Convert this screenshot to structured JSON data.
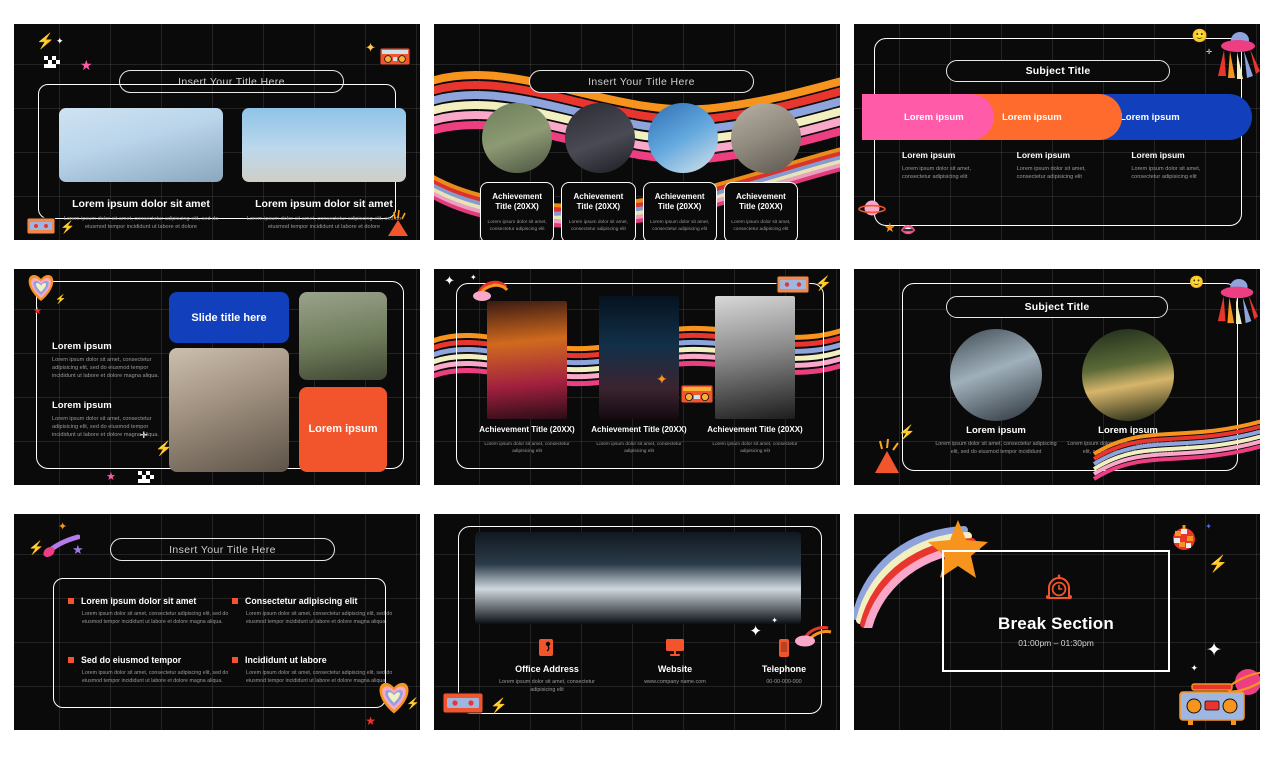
{
  "theme": {
    "bg": "#0a0a0a",
    "page_bg": "#ffffff",
    "accent_pink": "#FF5BA8",
    "accent_orange": "#FF6B2C",
    "accent_blue": "#1240BC",
    "accent_red_orange": "#F2552C",
    "text_muted": "#9a9a9a",
    "rainbow": [
      "#F7941E",
      "#E8352E",
      "#8FA3DC",
      "#F2EFC0",
      "#F9A8C9",
      "#ED3E82"
    ]
  },
  "lorem": {
    "short": "Lorem ipsum",
    "heading_long": "Lorem ipsum dolor sit amet",
    "body_3line": "Lorem ipsum dolor sit amet, consectetur adipiscing elit, sed do eiusmod tempor incididunt ut labore et dolore",
    "body_3line_b": "Lorem ipsum dolor sit amet, consectetur adipiscing elit",
    "body_5line": "Lorem ipsum dolor sit amet, consectetur adipiscing elit, sed do eiusmod tempor incididunt ut labore et dolore magna aliqua.",
    "body_4line": "Lorem ipsum dolor sit amet, consectetur adipiscing elit, sed do eiusmod tempor incididunt"
  },
  "slides": [
    {
      "index": 1,
      "name": "two-image-intro",
      "title": "Insert Your Title Here",
      "cards": [
        {
          "heading": "Lorem ipsum dolor sit amet",
          "body": "Lorem ipsum dolor sit amet, consectetur adipiscing elit, sed do eiusmod tempor incididunt ut labore et dolore"
        },
        {
          "heading": "Lorem ipsum dolor sit amet",
          "body": "Lorem ipsum dolor sit amet, consectetur adipiscing elit, sed do eiusmod tempor incididunt ut labore et dolore"
        }
      ],
      "decorations": [
        "bolt-icon",
        "sparkle-icon",
        "checkered-flag-icon",
        "pink-star-icon",
        "boombox-icon",
        "cassette-icon",
        "volcano-icon"
      ]
    },
    {
      "index": 2,
      "name": "four-achievements-wave",
      "title": "Insert Your Title Here",
      "items": [
        {
          "title": "Achievement Title (20XX)",
          "body": "Lorem ipsum dolor sit amet, consectetur adipiscing elit"
        },
        {
          "title": "Achievement Title (20XX)",
          "body": "Lorem ipsum dolor sit amet, consectetur adipiscing elit"
        },
        {
          "title": "Achievement Title (20XX)",
          "body": "Lorem ipsum dolor sit amet, consectetur adipiscing elit"
        },
        {
          "title": "Achievement Title (20XX)",
          "body": "Lorem ipsum dolor sit amet, consectetur adipiscing elit"
        }
      ],
      "decorations": [
        "rainbow-wave-icon"
      ]
    },
    {
      "index": 3,
      "name": "three-pill-process",
      "title": "Subject Title",
      "pills": [
        {
          "label": "Lorem ipsum",
          "color": "#FF5BA8"
        },
        {
          "label": "Lorem ipsum",
          "color": "#FF6B2C"
        },
        {
          "label": "Lorem ipsum",
          "color": "#1240BC"
        }
      ],
      "columns": [
        {
          "heading": "Lorem ipsum",
          "body": "Lorem ipsum dolor sit amet, consectetur adipisicing elit"
        },
        {
          "heading": "Lorem ipsum",
          "body": "Lorem ipsum dolor sit amet, consectetur adipisicing elit"
        },
        {
          "heading": "Lorem ipsum",
          "body": "Lorem ipsum dolor sit amet, consectetur adipisicing elit"
        }
      ],
      "decorations": [
        "smiley-icon",
        "ufo-icon",
        "plus-icon",
        "planet-icon",
        "orange-star-icon",
        "lips-icon"
      ]
    },
    {
      "index": 4,
      "name": "collage-two-text",
      "block_title": "Slide title here",
      "orange_block": "Lorem ipsum",
      "texts": [
        {
          "heading": "Lorem ipsum",
          "body": "Lorem ipsum dolor sit amet, consectetur adipisicing elit, sed do eiusmod tempor incididunt ut labore et dolore magna aliqua."
        },
        {
          "heading": "Lorem ipsum",
          "body": "Lorem ipsum dolor sit amet, consectetur adipisicing elit, sed do eiusmod tempor incididunt ut labore et dolore magna aliqua."
        }
      ],
      "decorations": [
        "rainbow-heart-icon",
        "bolt-icon",
        "red-star-icon",
        "pink-star-icon",
        "checkered-flag-icon",
        "plus-icon"
      ]
    },
    {
      "index": 5,
      "name": "three-achievements-photos",
      "items": [
        {
          "title": "Achievement Title (20XX)",
          "body": "Lorem ipsum dolor sit amet, consectetur adipisicing elit"
        },
        {
          "title": "Achievement Title (20XX)",
          "body": "Lorem ipsum dolor sit amet, consectetur adipisicing elit"
        },
        {
          "title": "Achievement Title (20XX)",
          "body": "Lorem ipsum dolor sit amet, consectetur adipisicing elit"
        }
      ],
      "decorations": [
        "sparkle-icon",
        "cloud-rainbow-icon",
        "cassette-icon",
        "bolt-icon",
        "boombox-icon",
        "orange-star-icon",
        "rainbow-wave-icon"
      ]
    },
    {
      "index": 6,
      "name": "two-circle-subject",
      "title": "Subject Title",
      "items": [
        {
          "heading": "Lorem ipsum",
          "body": "Lorem ipsum dolor sit amet, consectetur adipiscing elit, sed do eiusmod tempor incididunt"
        },
        {
          "heading": "Lorem ipsum",
          "body": "Lorem ipsum dolor sit amet, consectetur adipiscing elit, sed do eiusmod tempor incididunt"
        }
      ],
      "decorations": [
        "smiley-icon",
        "ufo-icon",
        "volcano-icon",
        "bolt-icon",
        "rainbow-wave-icon"
      ]
    },
    {
      "index": 7,
      "name": "four-bullet-grid",
      "title": "Insert Your Title Here",
      "bullets": [
        {
          "heading": "Lorem ipsum dolor sit amet",
          "body": "Lorem ipsum dolor sit amet, consectetur adipiscing elit, sed do eiusmod tempor incididunt ut labore et dolore magna aliqua."
        },
        {
          "heading": "Consectetur adipiscing elit",
          "body": "Lorem ipsum dolor sit amet, consectetur adipiscing elit, sed do eiusmod tempor incididunt ut labore et dolore magna aliqua."
        },
        {
          "heading": "Sed do eiusmod tempor",
          "body": "Lorem ipsum dolor sit amet, consectetur adipiscing elit, sed do eiusmod tempor incididunt ut labore et dolore magna aliqua."
        },
        {
          "heading": "Incididunt ut labore",
          "body": "Lorem ipsum dolor sit amet, consectetur adipiscing elit, sed do eiusmod tempor incididunt ut labore et dolore magna aliqua."
        }
      ],
      "decorations": [
        "shooting-star-icon",
        "bolt-icon",
        "purple-star-icon",
        "orange-sparkle-icon",
        "rainbow-heart-icon",
        "red-star-icon"
      ]
    },
    {
      "index": 8,
      "name": "contact-slide",
      "contacts": [
        {
          "icon": "map-pin-icon",
          "label": "Office Address",
          "value": "Lorem ipsum dolor sit amet, consectetur adipisicing elit"
        },
        {
          "icon": "monitor-icon",
          "label": "Website",
          "value": "www.company name.com"
        },
        {
          "icon": "phone-icon",
          "label": "Telephone",
          "value": "00-00-000-000"
        }
      ],
      "decorations": [
        "cassette-icon",
        "bolt-icon",
        "sparkle-icon",
        "cloud-rainbow-icon"
      ]
    },
    {
      "index": 9,
      "name": "break-section",
      "icon": "alarm-clock-icon",
      "title": "Break Section",
      "time": "01:00pm – 01:30pm",
      "decorations": [
        "shooting-rainbow-icon",
        "orange-star-icon",
        "disco-ball-icon",
        "bolt-icon",
        "blue-sparkle-icon",
        "white-sparkle-icon",
        "planet-icon",
        "boombox-icon"
      ]
    }
  ]
}
